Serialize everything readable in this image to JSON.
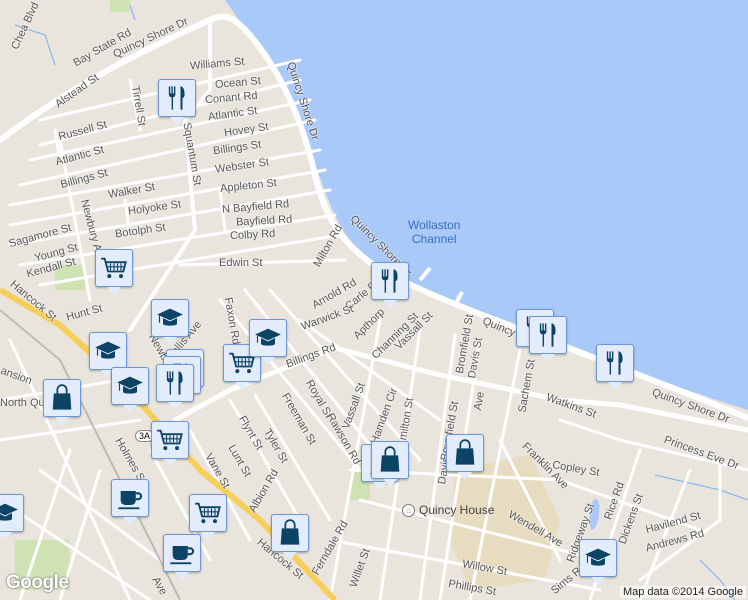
{
  "map": {
    "water_label": [
      "Wollaston",
      "Channel"
    ],
    "poi": {
      "label": "Quincy House",
      "icon": "building-icon"
    },
    "attribution": "Map data ©2014 Google",
    "logo": "Google",
    "route_shield": "3A",
    "colors": {
      "land": "#e9e5dc",
      "water": "#a9c9f8",
      "road": "#ffffff",
      "highway": "#f6cf5a",
      "marker_bg": "#e3ecfb",
      "marker_icon": "#0d4466"
    },
    "street_labels": [
      "Quincy Shore Dr",
      "Quincy Shore Dr",
      "Quincy Shore Dr",
      "Quincy Shore Dr",
      "Quincy Shore Dr",
      "Bay State Rd",
      "Williams St",
      "Ocean St",
      "Conant Rd",
      "Atlantic St",
      "Hovey St",
      "Billings St",
      "Webster St",
      "Appleton St",
      "N Bayfield Rd",
      "Bayfield Rd",
      "Colby Rd",
      "Edwin St",
      "Milton Rd",
      "Arnold Rd",
      "Carle Rd",
      "Warwick St",
      "Apthorp",
      "Channing St",
      "Vassall St",
      "Tirrell St",
      "Alstead St",
      "Russell St",
      "Atlantic St",
      "Billings St",
      "Walker St",
      "Holyoke St",
      "Botolph St",
      "Sagamore St",
      "Young St",
      "Kendall St",
      "Newbury Ave",
      "Squantum St",
      "Hunt St",
      "Hancock St",
      "Hancock St",
      "Hollis Ave",
      "Newbury Ave",
      "Faxon Rd",
      "Billings Rd",
      "Royal St",
      "Freeman St",
      "Rawson Rd",
      "Vassall St",
      "Hamden Cir",
      "Flynt St",
      "Tyler St",
      "Lunt St",
      "Vane St",
      "Holmes St",
      "Albion Rd",
      "Ferndale Rd",
      "Willet St",
      "Bromfield St",
      "Davis St",
      "Sachem St",
      "Watkins St",
      "Franklin Ave",
      "Copley St",
      "Princess Eve Dr",
      "Rice Rd",
      "Dickens St",
      "Ridgeway St",
      "Havilend St",
      "Andrews Rd",
      "Wendell Ave",
      "Willow St",
      "Phillips St",
      "Sims Rd",
      "Hamilton St",
      "Bromfield St",
      "Davis St",
      "North Quin",
      "ansion",
      "Chea Blvd",
      "Ave",
      "Ave"
    ],
    "markers": [
      "restaurant",
      "grocery",
      "school",
      "school",
      "school",
      "shopping",
      "restaurant",
      "restaurant",
      "restaurant",
      "grocery",
      "grocery",
      "school",
      "cafe",
      "grocery",
      "shopping",
      "cafe",
      "restaurant",
      "restaurant",
      "restaurant",
      "restaurant",
      "shopping",
      "shopping",
      "shopping",
      "school",
      "school"
    ]
  }
}
